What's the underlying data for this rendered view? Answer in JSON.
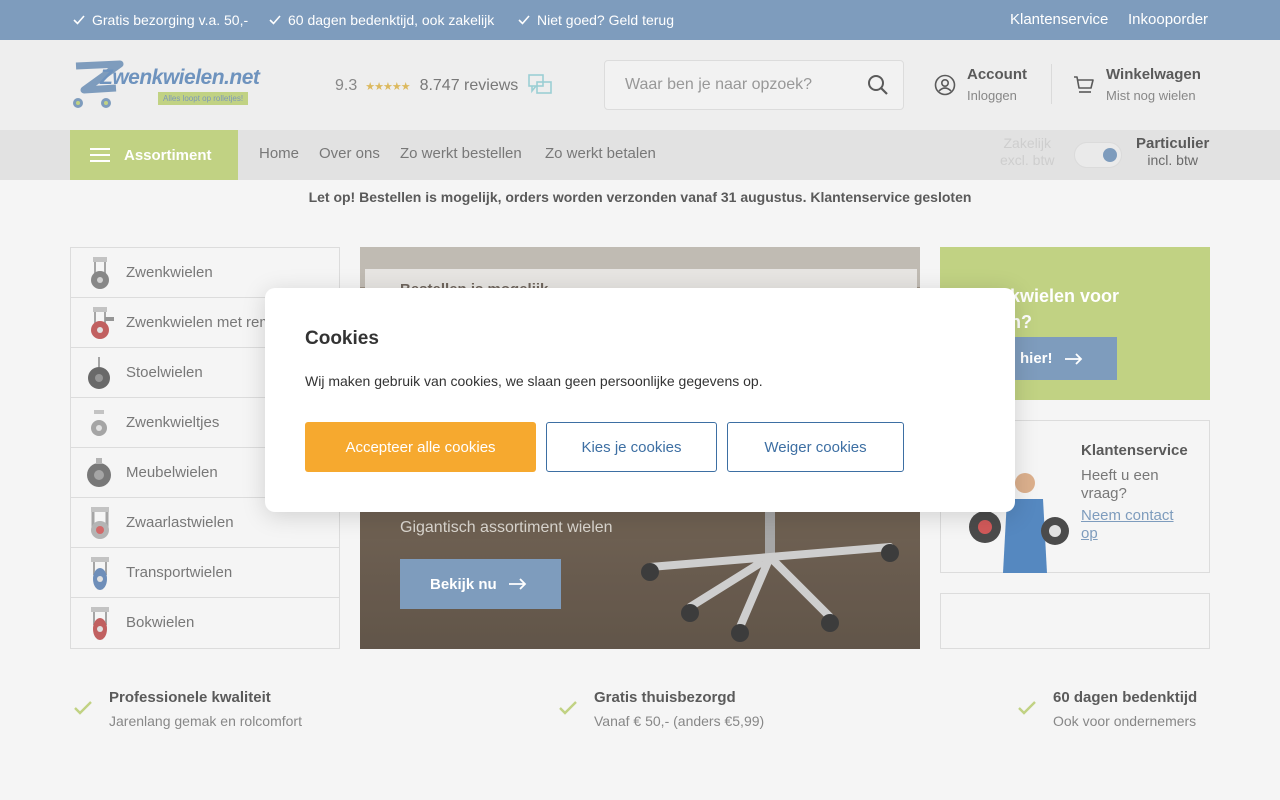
{
  "topbar": {
    "usps": [
      "Gratis bezorging v.a. 50,-",
      "60 dagen bedenktijd, ook zakelijk",
      "Niet goed? Geld terug"
    ],
    "links": [
      "Klantenservice",
      "Inkooporder"
    ]
  },
  "logo": {
    "wordmark": "Zwenkwielen.net",
    "slogan": "Alles loopt op rolletjes!"
  },
  "rating": {
    "score": "9.3",
    "stars": "★★★★★",
    "reviews": "8.747 reviews"
  },
  "search": {
    "placeholder": "Waar ben je naar opzoek?"
  },
  "account": {
    "title": "Account",
    "sub": "Inloggen"
  },
  "cart": {
    "title": "Winkelwagen",
    "sub": "Mist nog wielen"
  },
  "nav": {
    "assortiment": "Assortiment",
    "links": [
      "Home",
      "Over ons",
      "Zo werkt bestellen",
      "Zo werkt betalen"
    ],
    "toggle_left": {
      "title": "Zakelijk",
      "sub": "excl. btw"
    },
    "toggle_right": {
      "title": "Particulier",
      "sub": "incl. btw"
    }
  },
  "notice": "Let op! Bestellen is mogelijk, orders worden verzonden vanaf 31 augustus. Klantenservice gesloten",
  "categories": [
    "Zwenkwielen",
    "Zwenkwielen met rem",
    "Stoelwielen",
    "Zwenkwieltjes",
    "Meubelwielen",
    "Zwaarlastwielen",
    "Transportwielen",
    "Bokwielen"
  ],
  "hero": {
    "paper_text": "Bestellen is mogelijk",
    "tagline": "Gigantisch assortiment wielen",
    "cta": "Bekijk nu"
  },
  "promo": {
    "line1": "kwielen voor",
    "line2": "n?",
    "button": "hier!"
  },
  "service": {
    "title": "Klantenservice",
    "question": "Heeft u een vraag?",
    "link": "Neem contact op"
  },
  "bottom_usps": [
    {
      "title": "Professionele kwaliteit",
      "sub": "Jarenlang gemak en rolcomfort"
    },
    {
      "title": "Gratis thuisbezorgd",
      "sub": "Vanaf € 50,- (anders €5,99)"
    },
    {
      "title": "60 dagen bedenktijd",
      "sub": "Ook voor ondernemers"
    }
  ],
  "cookie_modal": {
    "title": "Cookies",
    "text": "Wij maken gebruik van cookies, we slaan geen persoonlijke gegevens op.",
    "accept": "Accepteer alle cookies",
    "choose": "Kies je cookies",
    "deny": "Weiger cookies"
  },
  "colors": {
    "brand_blue": "#6d8fb4",
    "brand_green": "#b9cc72",
    "accept_orange": "#f6a92f",
    "link_blue": "#3d6fa3"
  }
}
